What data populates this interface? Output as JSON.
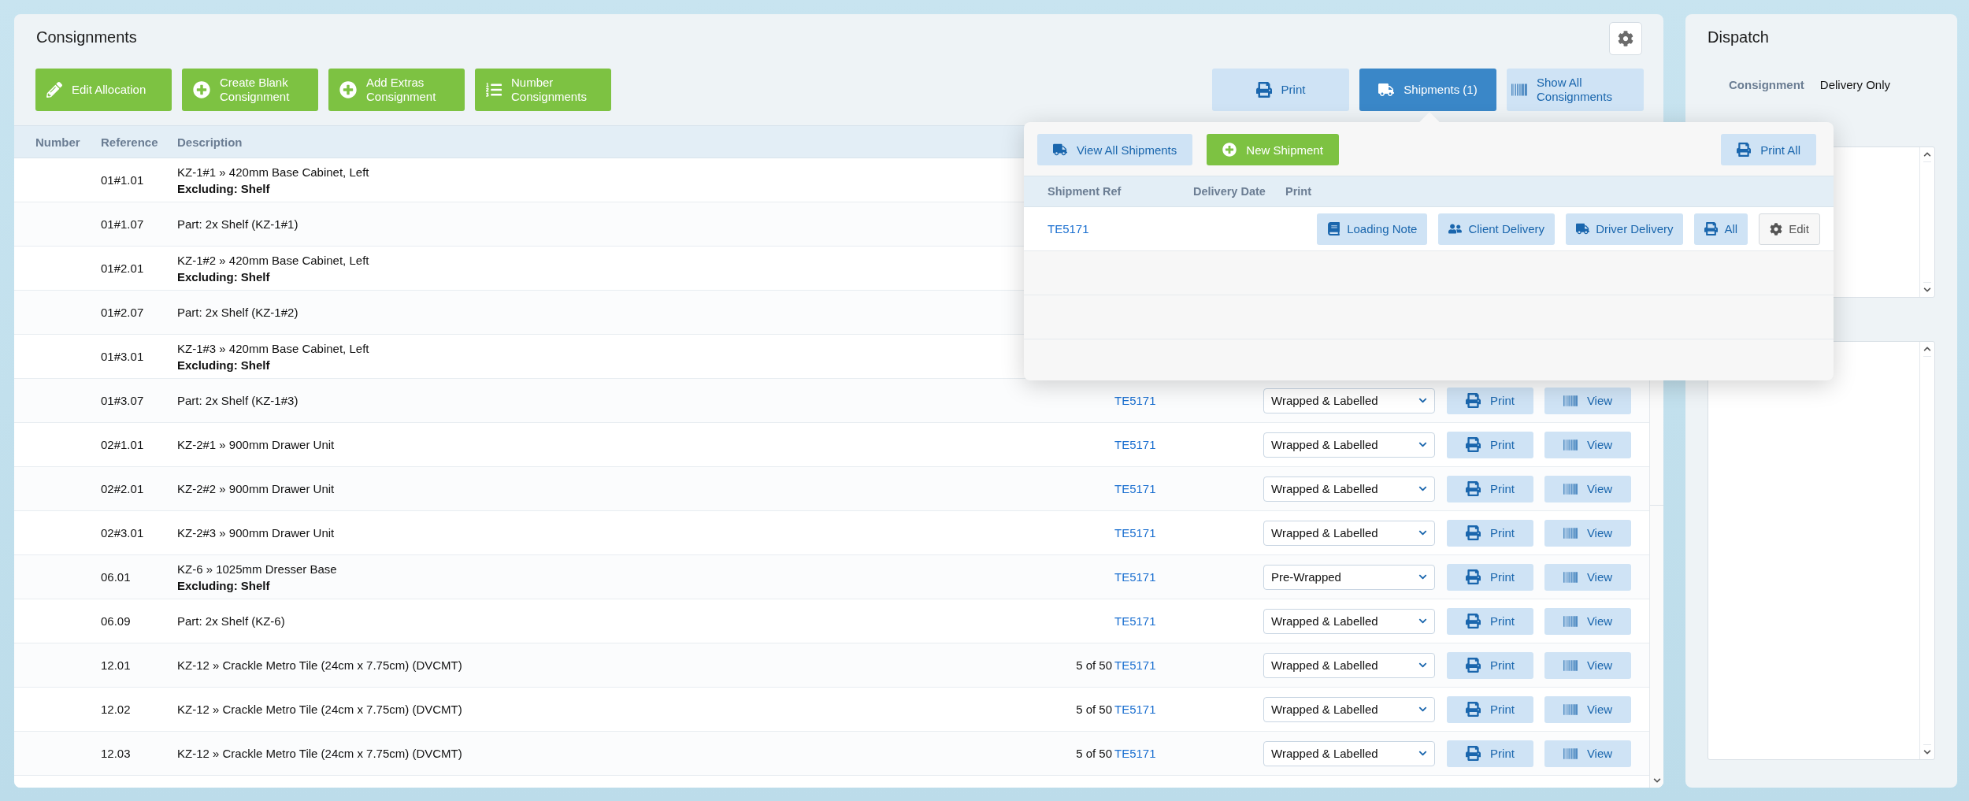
{
  "consignments_panel": {
    "title": "Consignments",
    "toolbar_left": [
      {
        "label": "Edit Allocation",
        "kind": "edit"
      },
      {
        "label": "Create Blank Consignment",
        "kind": "add"
      },
      {
        "label": "Add Extras Consignment",
        "kind": "add"
      },
      {
        "label": "Number Consignments",
        "kind": "number"
      }
    ],
    "toolbar_right": [
      {
        "label": "Print",
        "kind": "print",
        "selected": false
      },
      {
        "label": "Shipments (1)",
        "kind": "truck",
        "selected": true
      },
      {
        "label": "Show All Consignments",
        "kind": "barcode",
        "selected": false
      }
    ],
    "table": {
      "columns": [
        "Number",
        "Reference",
        "Description"
      ],
      "rows": [
        {
          "reference": "01#1.01",
          "description": "KZ-1#1 » 420mm Base Cabinet, Left",
          "note": "Excluding: Shelf"
        },
        {
          "reference": "01#1.07",
          "description": "Part: 2x Shelf (KZ-1#1)"
        },
        {
          "reference": "01#2.01",
          "description": "KZ-1#2 » 420mm Base Cabinet, Left",
          "note": "Excluding: Shelf"
        },
        {
          "reference": "01#2.07",
          "description": "Part: 2x Shelf (KZ-1#2)"
        },
        {
          "reference": "01#3.01",
          "description": "KZ-1#3 » 420mm Base Cabinet, Left",
          "note": "Excluding: Shelf"
        },
        {
          "reference": "01#3.07",
          "description": "Part: 2x Shelf (KZ-1#3)",
          "shipment_ref": "TE5171",
          "status": "Wrapped & Labelled",
          "actions": [
            "Print",
            "View"
          ]
        },
        {
          "reference": "02#1.01",
          "description": "KZ-2#1 » 900mm Drawer Unit",
          "shipment_ref": "TE5171",
          "status": "Wrapped & Labelled",
          "actions": [
            "Print",
            "View"
          ]
        },
        {
          "reference": "02#2.01",
          "description": "KZ-2#2 » 900mm Drawer Unit",
          "shipment_ref": "TE5171",
          "status": "Wrapped & Labelled",
          "actions": [
            "Print",
            "View"
          ]
        },
        {
          "reference": "02#3.01",
          "description": "KZ-2#3 » 900mm Drawer Unit",
          "shipment_ref": "TE5171",
          "status": "Wrapped & Labelled",
          "actions": [
            "Print",
            "View"
          ]
        },
        {
          "reference": "06.01",
          "description": "KZ-6 » 1025mm Dresser Base",
          "note": "Excluding: Shelf",
          "shipment_ref": "TE5171",
          "status": "Pre-Wrapped",
          "actions": [
            "Print",
            "View"
          ]
        },
        {
          "reference": "06.09",
          "description": "Part: 2x Shelf (KZ-6)",
          "shipment_ref": "TE5171",
          "status": "Wrapped & Labelled",
          "actions": [
            "Print",
            "View"
          ]
        },
        {
          "reference": "12.01",
          "description": "KZ-12 » Crackle Metro Tile (24cm x 7.75cm) (DVCMT)",
          "quantity": "5 of 50",
          "shipment_ref": "TE5171",
          "status": "Wrapped & Labelled",
          "actions": [
            "Print",
            "View"
          ]
        },
        {
          "reference": "12.02",
          "description": "KZ-12 » Crackle Metro Tile (24cm x 7.75cm) (DVCMT)",
          "quantity": "5 of 50",
          "shipment_ref": "TE5171",
          "status": "Wrapped & Labelled",
          "actions": [
            "Print",
            "View"
          ]
        },
        {
          "reference": "12.03",
          "description": "KZ-12 » Crackle Metro Tile (24cm x 7.75cm) (DVCMT)",
          "quantity": "5 of 50",
          "shipment_ref": "TE5171",
          "status": "Wrapped & Labelled",
          "actions": [
            "Print",
            "View"
          ]
        }
      ]
    }
  },
  "shipments_popup": {
    "open": true,
    "toolbar": [
      {
        "label": "View All Shipments",
        "kind": "truck"
      },
      {
        "label": "New Shipment",
        "kind": "add"
      },
      {
        "label": "Print All",
        "kind": "print_all"
      }
    ],
    "columns": [
      "Shipment Ref",
      "Delivery Date",
      "Print"
    ],
    "rows": [
      {
        "ref": "TE5171",
        "actions": [
          {
            "label": "Loading Note",
            "kind": "loading"
          },
          {
            "label": "Client Delivery",
            "kind": "client"
          },
          {
            "label": "Driver Delivery",
            "kind": "driver"
          },
          {
            "label": "All",
            "kind": "print"
          },
          {
            "label": "Edit",
            "kind": "edit"
          }
        ]
      }
    ]
  },
  "dispatch_panel": {
    "title": "Dispatch",
    "fields": [
      {
        "label": "Consignment",
        "value": "Delivery Only"
      }
    ]
  }
}
